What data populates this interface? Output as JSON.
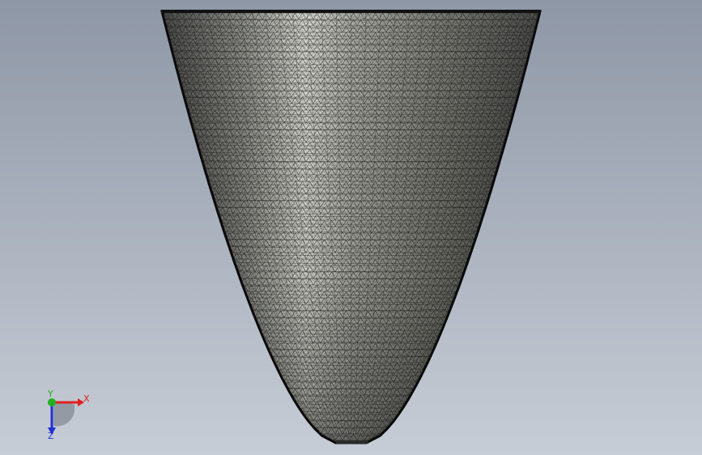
{
  "viewport": {
    "background_top": "#8e97a6",
    "background_bottom": "#c7cdd6"
  },
  "model": {
    "shape": "paraboloid-mesh",
    "surface_color": "#9b9d94",
    "highlight_color": "#e9ebe2",
    "mesh_color": "#141414"
  },
  "triad": {
    "x_label": "X",
    "y_label": "Y",
    "z_label": "Z",
    "x_color": "#e02020",
    "y_color": "#20b020",
    "z_color": "#2030d0"
  }
}
